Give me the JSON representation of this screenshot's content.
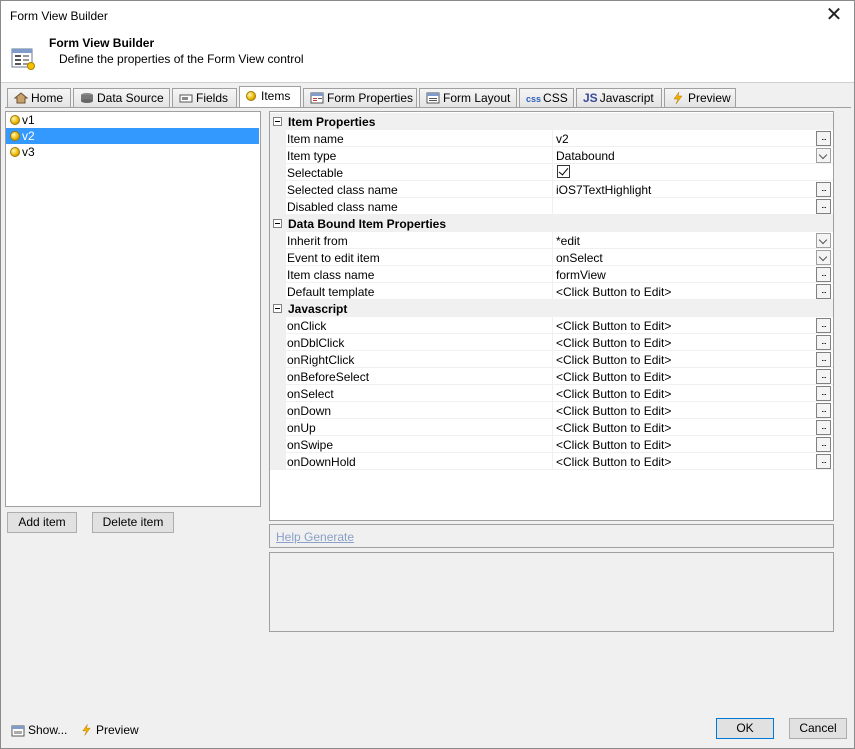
{
  "window": {
    "title": "Form View Builder",
    "close_glyph": "✕"
  },
  "banner": {
    "heading": "Form View Builder",
    "subtitle": "Define the properties of the Form View control",
    "icon": "form-icon"
  },
  "tabs": [
    {
      "label": "Home",
      "icon": "home-icon"
    },
    {
      "label": "Data Source",
      "icon": "database-icon"
    },
    {
      "label": "Fields",
      "icon": "fields-icon"
    },
    {
      "label": "Items",
      "icon": "item-dot-icon",
      "active": true
    },
    {
      "label": "Form Properties",
      "icon": "form-properties-icon"
    },
    {
      "label": "Form Layout",
      "icon": "form-layout-icon"
    },
    {
      "label": "CSS",
      "icon": "css-icon",
      "icon_text": "css"
    },
    {
      "label": "Javascript",
      "icon": "javascript-icon",
      "icon_text": "JS"
    },
    {
      "label": "Preview",
      "icon": "lightning-icon"
    }
  ],
  "items_list": [
    {
      "label": "v1"
    },
    {
      "label": "v2",
      "selected": true
    },
    {
      "label": "v3"
    }
  ],
  "buttons": {
    "add_item": "Add item",
    "delete_item": "Delete item",
    "ok": "OK",
    "cancel": "Cancel"
  },
  "grid": {
    "cat1": {
      "label": "Item Properties"
    },
    "cat2": {
      "label": "Data Bound Item Properties"
    },
    "cat3": {
      "label": "Javascript"
    },
    "item_name": {
      "name": "Item name",
      "value": "v2"
    },
    "item_type": {
      "name": "Item type",
      "value": "Databound"
    },
    "selectable": {
      "name": "Selectable",
      "value": "",
      "checked": true
    },
    "selected_class": {
      "name": "Selected class name",
      "value": "iOS7TextHighlight"
    },
    "disabled_class": {
      "name": "Disabled class name",
      "value": ""
    },
    "inherit_from": {
      "name": "Inherit from",
      "value": "*edit"
    },
    "event_to_edit": {
      "name": "Event to edit item",
      "value": "onSelect"
    },
    "item_class": {
      "name": "Item class name",
      "value": "formView"
    },
    "default_template": {
      "name": "Default template",
      "value": "<Click Button to Edit>"
    },
    "onclick": {
      "name": "onClick",
      "value": "<Click Button to Edit>"
    },
    "ondblclick": {
      "name": "onDblClick",
      "value": "<Click Button to Edit>"
    },
    "onrightclick": {
      "name": "onRightClick",
      "value": "<Click Button to Edit>"
    },
    "onbeforeselect": {
      "name": "onBeforeSelect",
      "value": "<Click Button to Edit>"
    },
    "onselect": {
      "name": "onSelect",
      "value": "<Click Button to Edit>"
    },
    "ondown": {
      "name": "onDown",
      "value": "<Click Button to Edit>"
    },
    "onup": {
      "name": "onUp",
      "value": "<Click Button to Edit>"
    },
    "onswipe": {
      "name": "onSwipe",
      "value": "<Click Button to Edit>"
    },
    "ondownhold": {
      "name": "onDownHold",
      "value": "<Click Button to Edit>"
    },
    "ellipsis": "..."
  },
  "help": {
    "link": "Help Generate"
  },
  "footer": {
    "show": "Show...",
    "preview": "Preview"
  }
}
